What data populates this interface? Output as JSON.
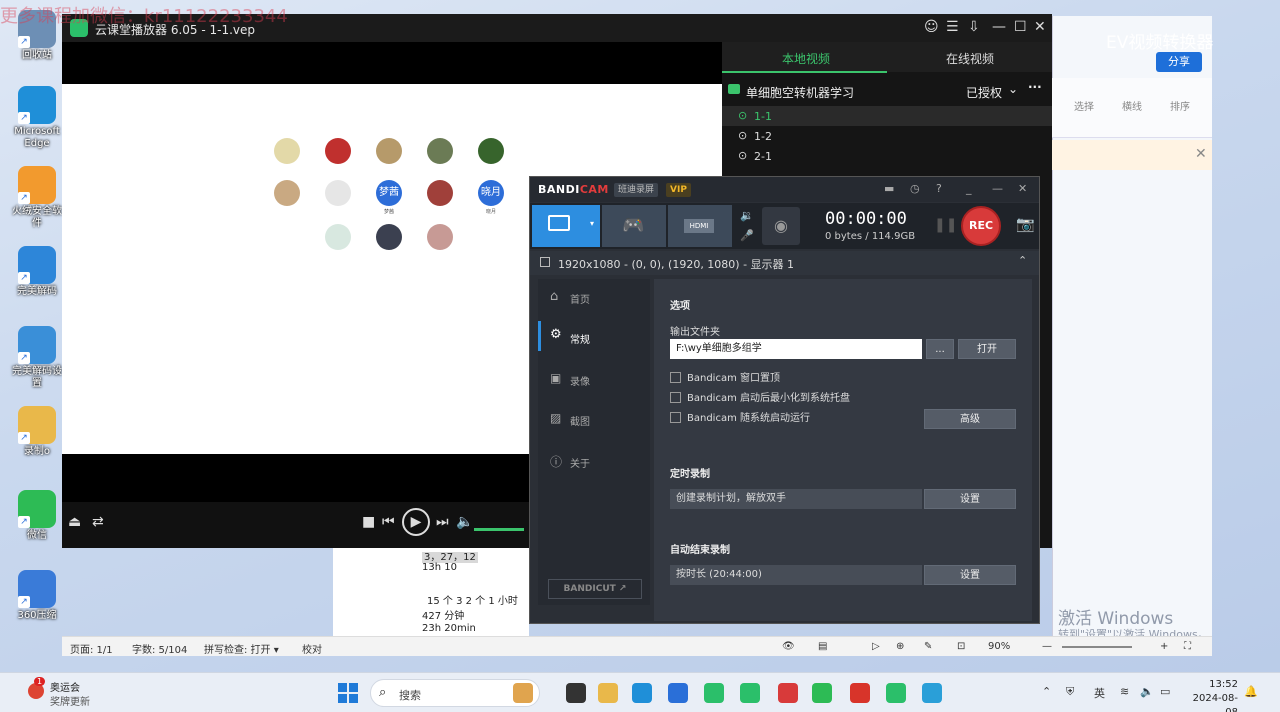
{
  "watermark": "更多课程加微信：kr11122233344",
  "desktop": {
    "icons": [
      {
        "label": "回收站",
        "color": "#6d8fb5"
      },
      {
        "label": "Microsoft Edge",
        "color": "#1f8fd8"
      },
      {
        "label": "火绒安全软件",
        "color": "#f29a2e"
      },
      {
        "label": "完美解码",
        "color": "#2d86d9"
      },
      {
        "label": "完美解码设置",
        "color": "#3a8fd8"
      },
      {
        "label": "录制o",
        "color": "#e9b84a"
      },
      {
        "label": "微信",
        "color": "#2dbb55"
      },
      {
        "label": "360压缩",
        "color": "#3a7bd8"
      }
    ]
  },
  "player": {
    "title": "云课堂播放器 6.05 - 1-1.vep",
    "tabs": {
      "local": "本地视频",
      "online": "在线视频"
    },
    "course": {
      "name": "单细胞空转机器学习",
      "status": "已授权"
    },
    "lessons": [
      "1-1",
      "1-2",
      "2-1"
    ],
    "avatars": [
      {
        "name": "",
        "color": "#e3d9a8"
      },
      {
        "name": "",
        "color": "#c0302e"
      },
      {
        "name": "",
        "color": "#b69a6a"
      },
      {
        "name": "",
        "color": "#6b7b55"
      },
      {
        "name": "",
        "color": "#37642c"
      },
      {
        "name": "",
        "color": "#c9a982"
      },
      {
        "name": "",
        "color": "#e6e6e6"
      },
      {
        "name": "梦茜",
        "color": "#2d6dd8",
        "text": "梦茜"
      },
      {
        "name": "",
        "color": "#a0403a"
      },
      {
        "name": "晓月",
        "color": "#2d6dd8",
        "text": "晓月"
      },
      {
        "name": "",
        "color": "#d8e8e0"
      },
      {
        "name": "",
        "color": "#3b4050"
      },
      {
        "name": "",
        "color": "#c79a95"
      }
    ]
  },
  "bandicam": {
    "logo_a": "BANDI",
    "logo_b": "CAM",
    "reg_badge": "班迪录屏",
    "vip_badge": "VIP",
    "timer": "00:00:00",
    "size": "0 bytes / 114.9GB",
    "rec_label": "REC",
    "region": "1920x1080 - (0, 0), (1920, 1080) - 显示器 1",
    "nav": [
      "首页",
      "常规",
      "录像",
      "截图",
      "关于"
    ],
    "options_title": "选项",
    "output_label": "输出文件夹",
    "output_path": "F:\\wy单细胞多组学",
    "browse_btn": "...",
    "open_btn": "打开",
    "checks": [
      "Bandicam 窗口置顶",
      "Bandicam 启动后最小化到系统托盘",
      "Bandicam 随系统启动运行"
    ],
    "advanced_btn": "高级",
    "schedule_title": "定时录制",
    "schedule_text": "创建录制计划，解放双手",
    "schedule_btn": "设置",
    "autostop_title": "自动结束录制",
    "autostop_text": "按时长 (20:44:00)",
    "autostop_btn": "设置",
    "bandicut": "BANDICUT ↗"
  },
  "ev": {
    "title": "EV视频转换器",
    "share": "分享",
    "tool1": "选择",
    "tool2": "横线",
    "tool3": "排序"
  },
  "document": {
    "lines": [
      "3，27，12",
      "13h 10",
      "15 个 3 2 个 1 小时",
      "427 分钟",
      "23h 20min"
    ]
  },
  "statusbar": {
    "page": "页面: 1/1",
    "words": "字数: 5/104",
    "spell": "拼写检查: 打开 ▾",
    "proof": "校对",
    "zoom": "90%"
  },
  "activation": {
    "line1": "激活 Windows",
    "line2": "转到\"设置\"以激活 Windows。"
  },
  "taskbar": {
    "news_title": "奥运会",
    "news_sub": "奖牌更新",
    "news_badge": "1",
    "search": "搜索",
    "ime": "英",
    "time": "13:52",
    "date": "2024-08-08"
  }
}
